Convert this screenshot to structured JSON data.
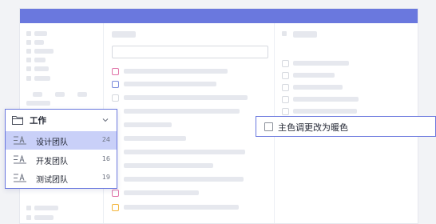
{
  "colors": {
    "accent": "#6a78de",
    "selected_bg": "#c9d0f8",
    "pink_marker": "#e072a8",
    "blue_marker": "#7a8bdc",
    "yellow_marker": "#f3b53a"
  },
  "dropdown": {
    "header": {
      "icon": "folder-icon",
      "title": "工作",
      "chevron": "chevron-down-icon"
    },
    "items": [
      {
        "icon": "group-list-icon",
        "label": "设计团队",
        "count": "24",
        "selected": true
      },
      {
        "icon": "group-list-icon",
        "label": "开发团队",
        "count": "16",
        "selected": false
      },
      {
        "icon": "group-list-icon",
        "label": "测试团队",
        "count": "19",
        "selected": false
      }
    ]
  },
  "option": {
    "label": "主色调更改为暖色",
    "checked": false
  }
}
